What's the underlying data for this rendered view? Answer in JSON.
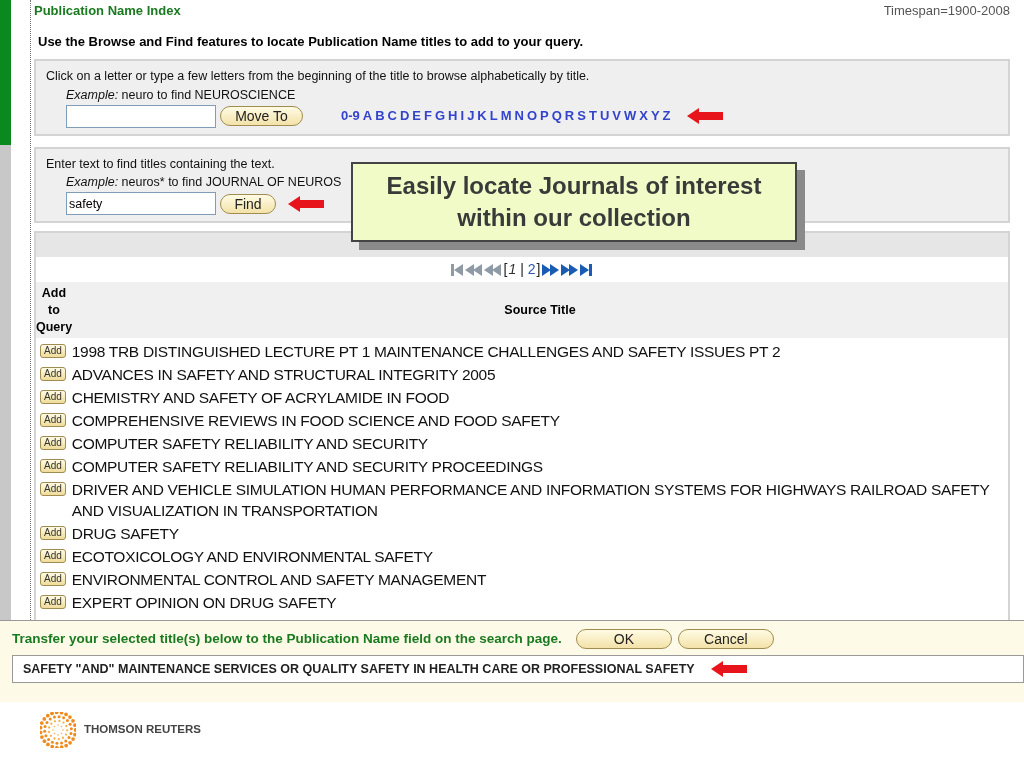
{
  "header": {
    "title": "Publication Name Index",
    "timespan": "Timespan=1900-2008"
  },
  "instructions": "Use the Browse and Find features to locate Publication Name titles to add to your query.",
  "browse": {
    "text": "Click on a letter or type a few letters from the beginning of the title to browse alphabetically by title.",
    "example_label": "Example:",
    "example_text": " neuro to find NEUROSCIENCE",
    "button": "Move To",
    "letters": [
      "0-9",
      "A",
      "B",
      "C",
      "D",
      "E",
      "F",
      "G",
      "H",
      "I",
      "J",
      "K",
      "L",
      "M",
      "N",
      "O",
      "P",
      "Q",
      "R",
      "S",
      "T",
      "U",
      "V",
      "W",
      "X",
      "Y",
      "Z"
    ]
  },
  "find": {
    "text": "Enter text to find titles containing the text.",
    "example_label": "Example:",
    "example_text": " neuros* to find JOURNAL OF NEUROS",
    "value": "safety",
    "button": "Find"
  },
  "callout": "Easily locate Journals of interest within our collection",
  "pagination": {
    "back_enabled": false,
    "forward_enabled": true,
    "open": "[",
    "separator": "|",
    "close": "]",
    "pages": [
      {
        "label": "1",
        "selected": true
      },
      {
        "label": "2",
        "selected": false
      }
    ]
  },
  "table": {
    "columns": [
      "Add to Query",
      "Source Title"
    ],
    "rows": [
      {
        "add": "Add",
        "title": "1998 TRB DISTINGUISHED LECTURE PT 1 MAINTENANCE CHALLENGES AND SAFETY ISSUES PT 2"
      },
      {
        "add": "Add",
        "title": "ADVANCES IN SAFETY AND STRUCTURAL INTEGRITY 2005"
      },
      {
        "add": "Add",
        "title": "CHEMISTRY AND SAFETY OF ACRYLAMIDE IN FOOD"
      },
      {
        "add": "Add",
        "title": "COMPREHENSIVE REVIEWS IN FOOD SCIENCE AND FOOD SAFETY"
      },
      {
        "add": "Add",
        "title": "COMPUTER SAFETY RELIABILITY AND SECURITY"
      },
      {
        "add": "Add",
        "title": "COMPUTER SAFETY RELIABILITY AND SECURITY PROCEEDINGS"
      },
      {
        "add": "Add",
        "title": "DRIVER AND VEHICLE SIMULATION HUMAN PERFORMANCE AND INFORMATION SYSTEMS FOR HIGHWAYS RAILROAD SAFETY AND VISUALIZATION IN TRANSPORTATION"
      },
      {
        "add": "Add",
        "title": "DRUG SAFETY"
      },
      {
        "add": "Add",
        "title": "ECOTOXICOLOGY AND ENVIRONMENTAL SAFETY"
      },
      {
        "add": "Add",
        "title": "ENVIRONMENTAL CONTROL AND SAFETY MANAGEMENT"
      },
      {
        "add": "Add",
        "title": "EXPERT OPINION ON DRUG SAFETY"
      }
    ]
  },
  "transfer": {
    "text": "Transfer your selected title(s) below to the Publication Name field on the search page.",
    "buttons": [
      "OK",
      "Cancel"
    ],
    "value": "SAFETY \"AND\" MAINTENANCE SERVICES OR QUALITY SAFETY IN HEALTH CARE OR PROFESSIONAL SAFETY"
  },
  "footer": {
    "logo_text": "THOMSON REUTERS"
  }
}
